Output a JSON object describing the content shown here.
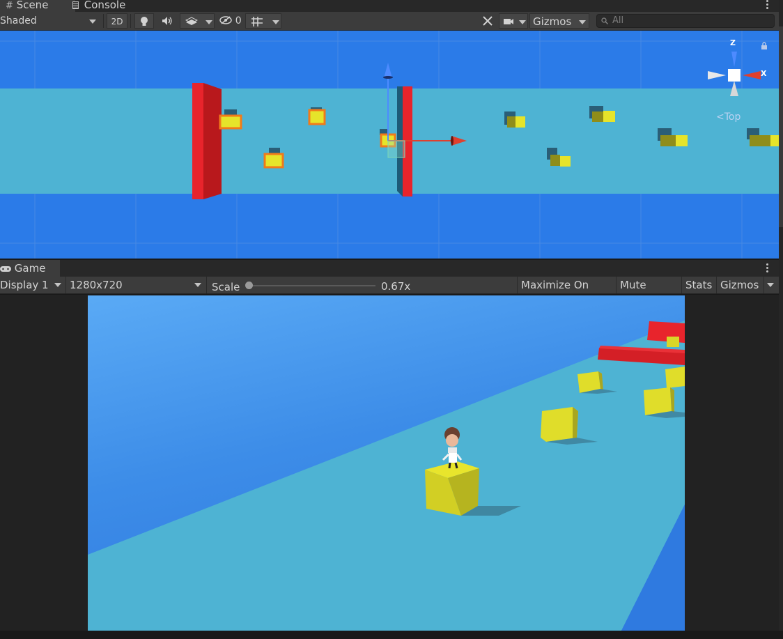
{
  "scene_tabs": [
    {
      "label": "Scene",
      "icon": "hash-icon"
    },
    {
      "label": "Console",
      "icon": "console-icon"
    }
  ],
  "scene_toolbar": {
    "shading_mode": "Shaded",
    "toggle_2d": "2D",
    "hidden_count": "0",
    "gizmos_label": "Gizmos",
    "search_placeholder": "All"
  },
  "orientation_gizmo": {
    "axis_z": "Z",
    "axis_x": "X",
    "view_label": "Top",
    "colors": {
      "z": "#4d8bff",
      "x": "#e0402e",
      "center": "#ffffff"
    }
  },
  "game_tab": {
    "label": "Game",
    "icon": "gamepad-icon"
  },
  "game_toolbar": {
    "display": "Display 1",
    "resolution": "1280x720",
    "scale_label": "Scale",
    "scale_value": "0.67x",
    "scale_level": 0.0,
    "buttons": [
      "Maximize On Play",
      "Mute Audio",
      "Stats",
      "Gizmos"
    ]
  },
  "colors": {
    "sky": "#2b7be8",
    "track": "#4eb3d3",
    "obstacle": "#e8242c",
    "cube": "#e6e42a",
    "selection": "#f07a1a",
    "panel_bg": "#3c3c3c",
    "tab_bg": "#282828"
  }
}
